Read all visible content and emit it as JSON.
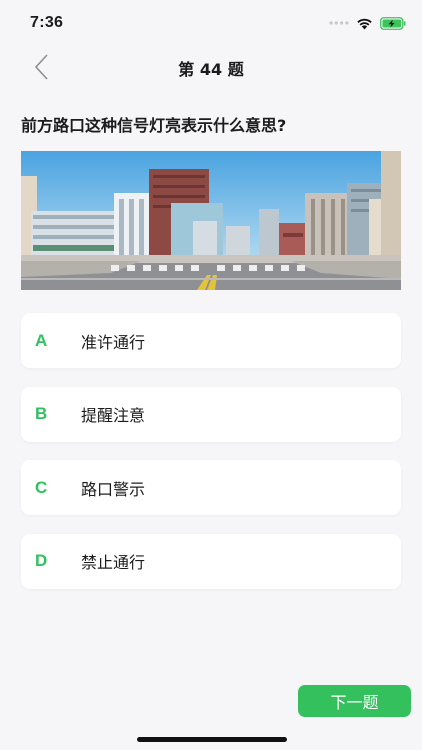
{
  "status_bar": {
    "time": "7:36",
    "icons": [
      "signal-dots-icon",
      "wifi-icon",
      "battery-charging-icon"
    ],
    "battery_color": "#3ac45a"
  },
  "nav": {
    "back_icon": "chevron-left-icon",
    "title": "第 44 题"
  },
  "question": {
    "text": "前方路口这种信号灯亮表示什么意思?"
  },
  "options": [
    {
      "letter": "A",
      "text": "准许通行"
    },
    {
      "letter": "B",
      "text": "提醒注意"
    },
    {
      "letter": "C",
      "text": "路口警示"
    },
    {
      "letter": "D",
      "text": "禁止通行"
    }
  ],
  "next_button": {
    "label": "下一题"
  },
  "colors": {
    "accent": "#34c15d",
    "option_letter": "#32c160",
    "background": "#f6f6f8"
  }
}
